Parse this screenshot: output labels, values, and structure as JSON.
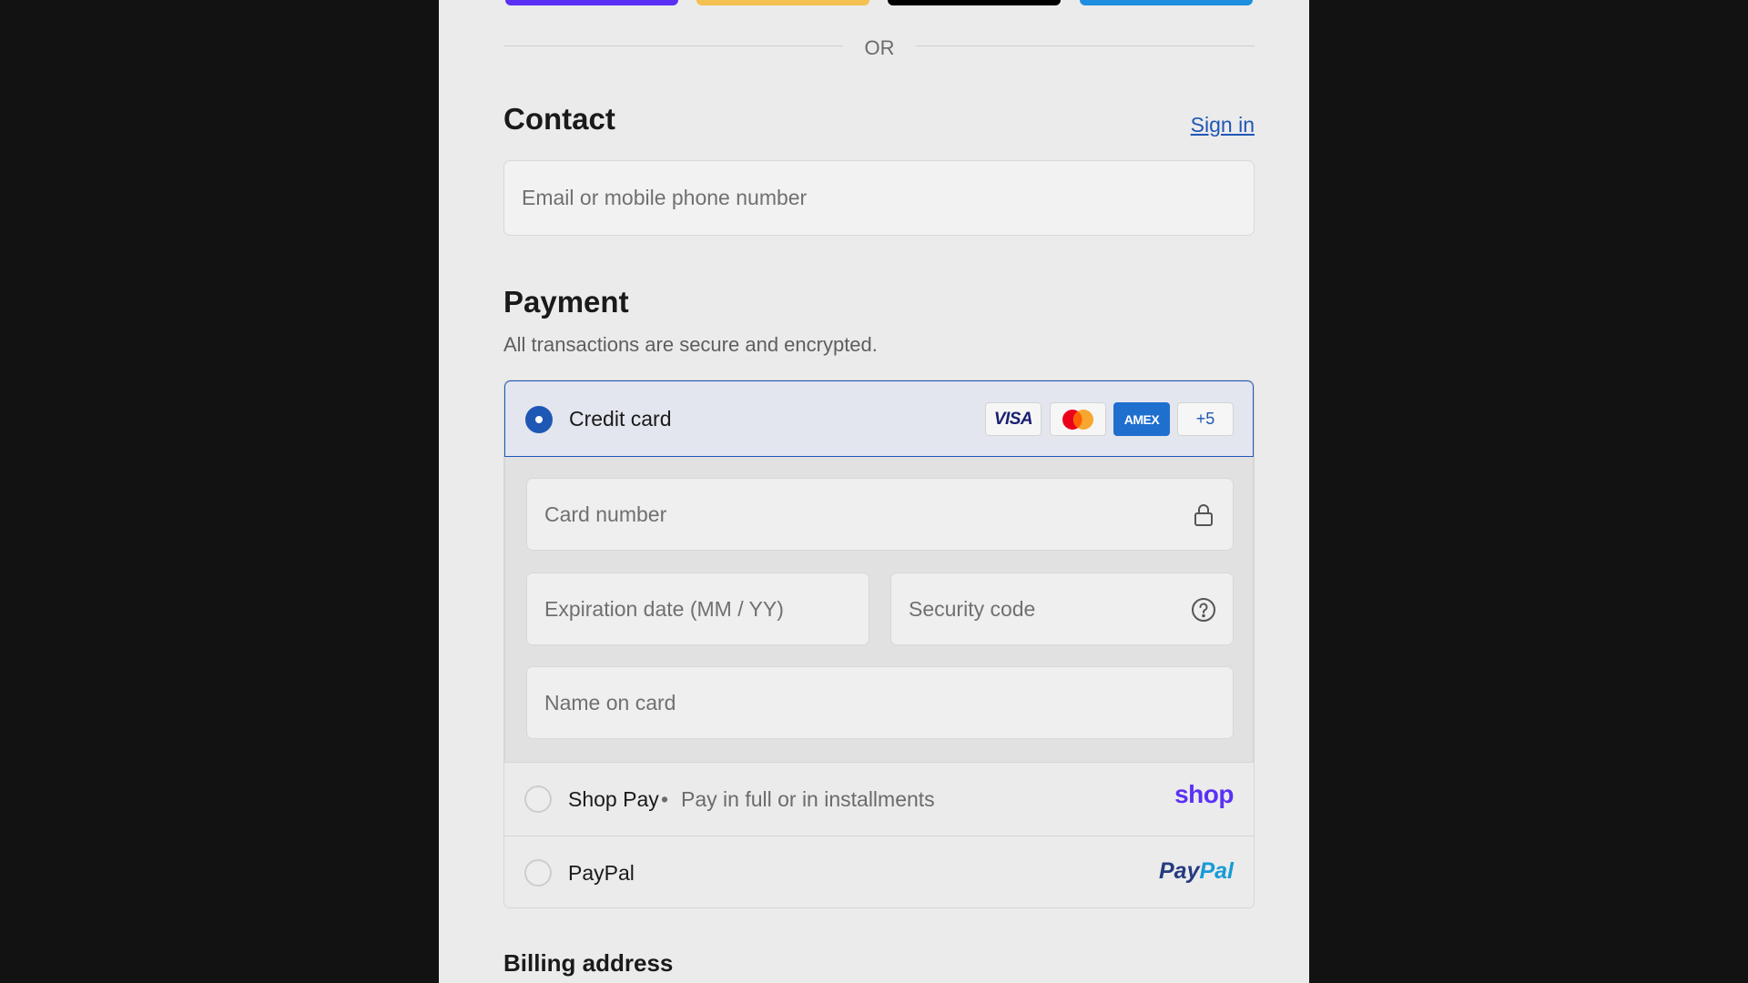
{
  "express": {
    "buttons": [
      "shop-pay-express",
      "amazon-pay-express",
      "google-pay-express",
      "venmo-express"
    ]
  },
  "divider": {
    "or_text": "OR"
  },
  "contact": {
    "title": "Contact",
    "sign_in": "Sign in",
    "email_placeholder": "Email or mobile phone number"
  },
  "payment": {
    "title": "Payment",
    "subtitle": "All transactions are secure and encrypted.",
    "credit_card": {
      "label": "Credit card",
      "selected": true,
      "logos": {
        "visa": "VISA",
        "amex": "AMEX",
        "more": "+5"
      },
      "card_number_placeholder": "Card number",
      "expiration_placeholder": "Expiration date (MM / YY)",
      "security_code_placeholder": "Security code",
      "name_placeholder": "Name on card"
    },
    "shop_pay": {
      "label": "Shop Pay",
      "separator": "•",
      "description": "Pay in full or in installments",
      "logo_text": "shop"
    },
    "paypal": {
      "label": "PayPal",
      "logo_part1": "Pay",
      "logo_part2": "Pal"
    }
  },
  "billing": {
    "title": "Billing address"
  },
  "colors": {
    "accent": "#1f57b5",
    "shop_purple": "#5a31f4",
    "background": "#ebebeb",
    "outer": "#121212"
  }
}
